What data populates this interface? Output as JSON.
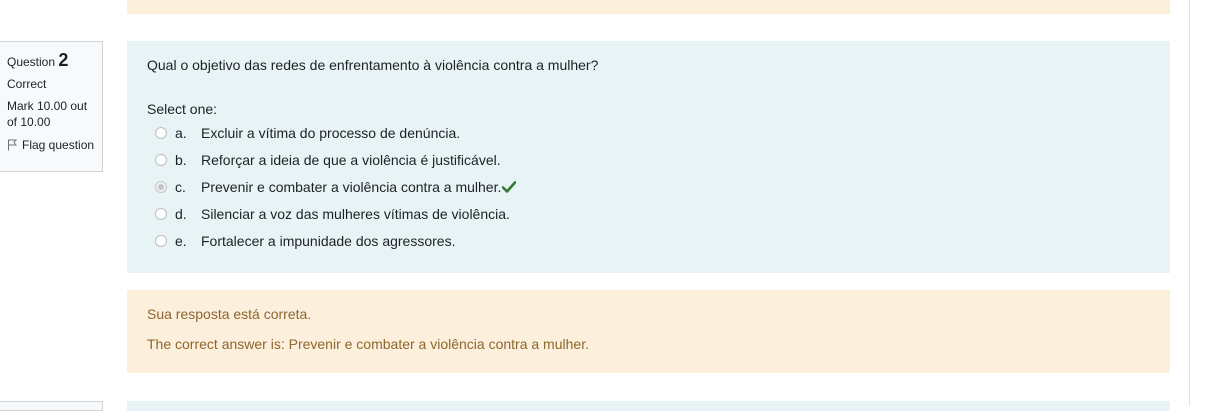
{
  "question": {
    "label": "Question",
    "number": "2",
    "state": "Correct",
    "grade": "Mark 10.00 out of 10.00",
    "flag_label": "Flag question",
    "text": "Qual o objetivo das redes de enfrentamento à violência contra a mulher?",
    "prompt": "Select one:",
    "options": [
      {
        "letter": "a.",
        "text": "Excluir a vítima do processo de denúncia.",
        "checked": false
      },
      {
        "letter": "b.",
        "text": "Reforçar a ideia de que a violência é justificável.",
        "checked": false
      },
      {
        "letter": "c.",
        "text": "Prevenir e combater a violência contra a mulher.",
        "checked": true
      },
      {
        "letter": "d.",
        "text": "Silenciar a voz das mulheres vítimas de violência.",
        "checked": false
      },
      {
        "letter": "e.",
        "text": "Fortalecer a impunidade dos agressores.",
        "checked": false
      }
    ],
    "correct_icon": "check-icon"
  },
  "feedback": {
    "specific": "Sua resposta está correta.",
    "right_answer": "The correct answer is: Prevenir e combater a violência contra a mulher."
  },
  "colors": {
    "formulation_bg": "#e7f3f5",
    "feedback_bg": "#fcefdc",
    "feedback_text": "#8e662e",
    "check": "#357a32"
  }
}
